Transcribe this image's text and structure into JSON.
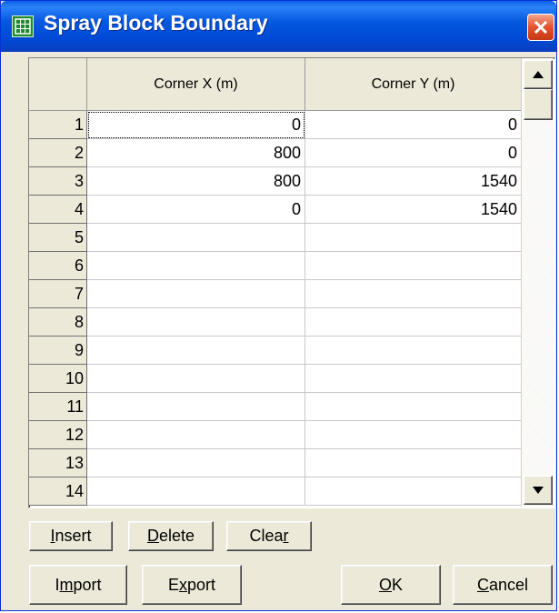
{
  "window": {
    "title": "Spray Block Boundary",
    "title_icon": "app-grid-icon",
    "close_icon": "close-icon",
    "colors": {
      "titlebar": "#0a55dc",
      "close": "#e3522d",
      "face": "#ece9d8"
    }
  },
  "grid": {
    "columns": [
      "Corner X (m)",
      "Corner Y (m)"
    ],
    "rows": [
      {
        "n": "1",
        "x": "0",
        "y": "0"
      },
      {
        "n": "2",
        "x": "800",
        "y": "0"
      },
      {
        "n": "3",
        "x": "800",
        "y": "1540"
      },
      {
        "n": "4",
        "x": "0",
        "y": "1540"
      },
      {
        "n": "5",
        "x": "",
        "y": ""
      },
      {
        "n": "6",
        "x": "",
        "y": ""
      },
      {
        "n": "7",
        "x": "",
        "y": ""
      },
      {
        "n": "8",
        "x": "",
        "y": ""
      },
      {
        "n": "9",
        "x": "",
        "y": ""
      },
      {
        "n": "10",
        "x": "",
        "y": ""
      },
      {
        "n": "11",
        "x": "",
        "y": ""
      },
      {
        "n": "12",
        "x": "",
        "y": ""
      },
      {
        "n": "13",
        "x": "",
        "y": ""
      },
      {
        "n": "14",
        "x": "",
        "y": ""
      }
    ]
  },
  "buttons": {
    "insert": {
      "label": "Insert",
      "accel": "I"
    },
    "delete": {
      "label": "Delete",
      "accel": "D"
    },
    "clear": {
      "label": "Clear",
      "accel": "r"
    },
    "import": {
      "label": "Import",
      "accel": "m"
    },
    "export": {
      "label": "Export",
      "accel": "x"
    },
    "ok": {
      "label": "OK",
      "accel": "O"
    },
    "cancel": {
      "label": "Cancel",
      "accel": "C"
    }
  }
}
